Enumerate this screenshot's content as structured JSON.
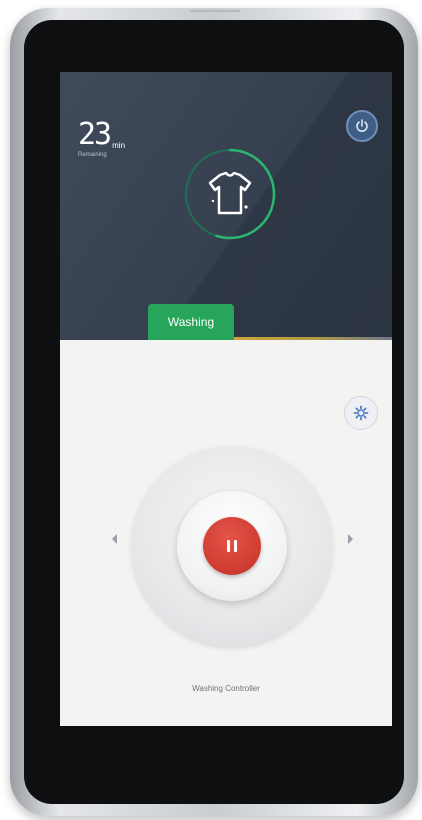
{
  "timer": {
    "value": "23",
    "unit": "min",
    "sub_label": "Remaining"
  },
  "icons": {
    "power": "power-icon",
    "laundry": "shirt-icon",
    "settings": "gear-icon",
    "pause": "pause-icon"
  },
  "status": {
    "label": "Washing",
    "progress": 0.55
  },
  "controller": {
    "label": "Washing Controller"
  },
  "colors": {
    "panel_dark": "#3a4455",
    "accent_green": "#27a55a",
    "pause_red": "#cf3b30",
    "power_blue": "#3f5e86"
  }
}
